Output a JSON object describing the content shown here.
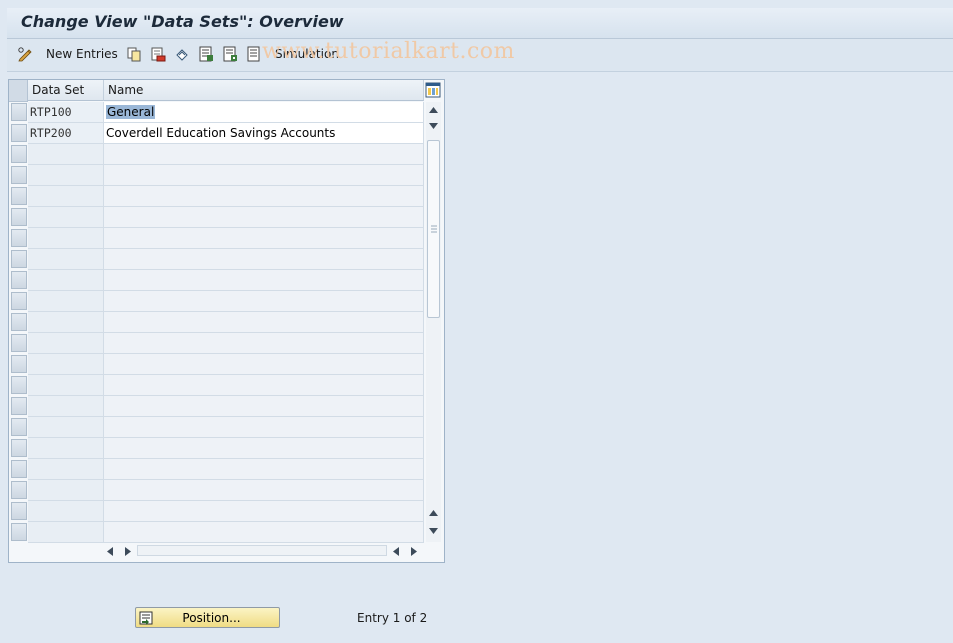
{
  "window": {
    "title": "Change View \"Data Sets\": Overview"
  },
  "toolbar": {
    "new_entries_label": "New Entries",
    "simulation_label": "Simulation",
    "icons": [
      "edit-display-icon",
      "copy-icon",
      "delete-icon",
      "undo-icon",
      "select-all-icon",
      "select-block-icon",
      "deselect-icon",
      "print-icon"
    ]
  },
  "watermark": "www.tutorialkart.com",
  "table": {
    "columns": [
      "Data Set",
      "Name"
    ],
    "rows": [
      {
        "key": "RTP100",
        "name": "General",
        "selected": true
      },
      {
        "key": "RTP200",
        "name": "Coverdell Education Savings Accounts",
        "selected": false
      }
    ],
    "empty_rows": 19
  },
  "footer": {
    "position_button_label": "Position...",
    "entry_status": "Entry 1 of 2"
  },
  "colors": {
    "background": "#dfe8f2",
    "button_yellow": "#f0dc84",
    "selection": "#9ab7d7"
  }
}
